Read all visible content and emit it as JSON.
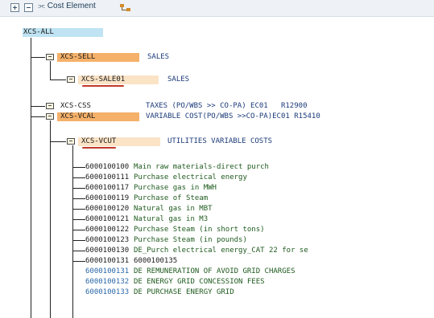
{
  "toolbar": {
    "cost_element_label": "Cost Element"
  },
  "root": {
    "id": "XCS-ALL"
  },
  "groups": [
    {
      "id": "XCS-SELL",
      "desc": "SALES"
    },
    {
      "id": "XCS-SALE01",
      "desc": "SALES"
    },
    {
      "id": "XCS-CSS",
      "desc": "TAXES (PO/WBS >> CO-PA) EC01   R12900"
    },
    {
      "id": "XCS-VCAL",
      "desc": "VARIABLE COST(PO/WBS >>CO-PA)EC01 R15410"
    },
    {
      "id": "XCS-VCUT",
      "desc": "UTILITIES VARIABLE COSTS"
    }
  ],
  "cost_elements": [
    {
      "id": "6000100100",
      "name": "Main raw materials-direct purch"
    },
    {
      "id": "6000100111",
      "name": "Purchase electrical energy"
    },
    {
      "id": "6000100117",
      "name": "Purchase gas in MWH"
    },
    {
      "id": "6000100119",
      "name": "Purchase of Steam"
    },
    {
      "id": "6000100120",
      "name": "Natural gas in MBT"
    },
    {
      "id": "6000100121",
      "name": "Natural gas in M3"
    },
    {
      "id": "6000100122",
      "name": "Purchase Steam (in short tons)"
    },
    {
      "id": "6000100123",
      "name": "Purchase Steam (in pounds)"
    },
    {
      "id": "6000100130",
      "name": "DE_Purch electrical energy_CAT 22 for se"
    },
    {
      "id": "6000100131",
      "name": "6000100135"
    },
    {
      "id": "6000100131",
      "name": "DE REMUNERATION OF AVOID GRID CHARGES"
    },
    {
      "id": "6000100132",
      "name": "DE ENERGY GRID CONCESSION FEES"
    },
    {
      "id": "6000100133",
      "name": "DE PURCHASE ENERGY GRID"
    }
  ],
  "colors": {
    "root_highlight": "#bfe3f2",
    "group_highlight": "#f5b16a",
    "group_highlight_light": "#fbe3c6",
    "toolbar_bg": "#eef2f6"
  }
}
